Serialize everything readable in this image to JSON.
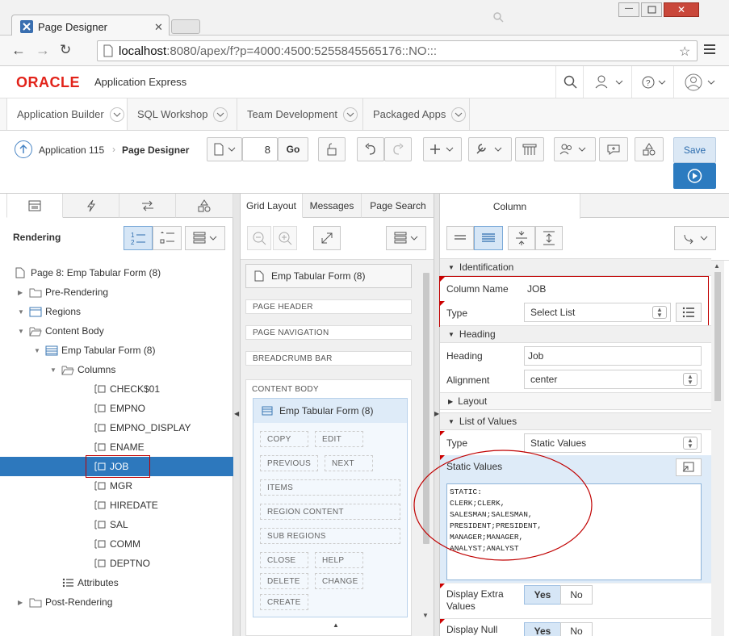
{
  "browser": {
    "tab_title": "Page Designer",
    "url_host": "localhost",
    "url_rest": ":8080/apex/f?p=4000:4500:5255845565176::NO:::"
  },
  "apex": {
    "logo_oracle": "ORACLE",
    "logo_product": "Application Express",
    "nav_tabs": [
      "Application Builder",
      "SQL Workshop",
      "Team Development",
      "Packaged Apps"
    ],
    "breadcrumb_app": "Application 115",
    "breadcrumb_page": "Page Designer",
    "page_number": "8",
    "go_label": "Go",
    "save_label": "Save"
  },
  "left_panel": {
    "heading": "Rendering",
    "tree": [
      {
        "label": "Page 8: Emp Tabular Form (8)",
        "level": 0,
        "icon": "page-icon",
        "toggle": ""
      },
      {
        "label": "Pre-Rendering",
        "level": 1,
        "icon": "folder-icon",
        "toggle": "right"
      },
      {
        "label": "Regions",
        "level": 1,
        "icon": "region-icon",
        "toggle": "down"
      },
      {
        "label": "Content Body",
        "level": 2,
        "icon": "folder-open-icon",
        "toggle": "down"
      },
      {
        "label": "Emp Tabular Form (8)",
        "level": 3,
        "icon": "tabular-form-icon",
        "toggle": "down"
      },
      {
        "label": "Columns",
        "level": 4,
        "icon": "folder-open-icon",
        "toggle": "down"
      },
      {
        "label": "CHECK$01",
        "level": 5,
        "icon": "column-icon",
        "toggle": ""
      },
      {
        "label": "EMPNO",
        "level": 5,
        "icon": "column-icon",
        "toggle": ""
      },
      {
        "label": "EMPNO_DISPLAY",
        "level": 5,
        "icon": "column-icon",
        "toggle": ""
      },
      {
        "label": "ENAME",
        "level": 5,
        "icon": "column-icon",
        "toggle": ""
      },
      {
        "label": "JOB",
        "level": 5,
        "icon": "column-icon",
        "toggle": "",
        "selected": true
      },
      {
        "label": "MGR",
        "level": 5,
        "icon": "column-icon",
        "toggle": ""
      },
      {
        "label": "HIREDATE",
        "level": 5,
        "icon": "column-icon",
        "toggle": ""
      },
      {
        "label": "SAL",
        "level": 5,
        "icon": "column-icon",
        "toggle": ""
      },
      {
        "label": "COMM",
        "level": 5,
        "icon": "column-icon",
        "toggle": ""
      },
      {
        "label": "DEPTNO",
        "level": 5,
        "icon": "column-icon",
        "toggle": ""
      },
      {
        "label": "Attributes",
        "level": 4,
        "icon": "attributes-icon",
        "toggle": ""
      },
      {
        "label": "Post-Rendering",
        "level": 1,
        "icon": "folder-icon",
        "toggle": "right"
      }
    ]
  },
  "mid_panel": {
    "tabs": [
      "Grid Layout",
      "Messages",
      "Page Search"
    ],
    "page_title": "Emp Tabular Form (8)",
    "positions": [
      "PAGE HEADER",
      "PAGE NAVIGATION",
      "BREADCRUMB BAR"
    ],
    "content_body_label": "CONTENT BODY",
    "region_title": "Emp Tabular Form (8)",
    "slots": [
      {
        "label": "COPY"
      },
      {
        "label": "EDIT"
      },
      {
        "label": "PREVIOUS"
      },
      {
        "label": "NEXT"
      },
      {
        "label": "ITEMS"
      },
      {
        "label": "REGION CONTENT"
      },
      {
        "label": "SUB REGIONS"
      },
      {
        "label": "CLOSE"
      },
      {
        "label": "HELP"
      },
      {
        "label": "DELETE"
      },
      {
        "label": "CHANGE"
      },
      {
        "label": "CREATE"
      }
    ]
  },
  "right_panel": {
    "tab": "Column",
    "sections": {
      "identification": "Identification",
      "heading": "Heading",
      "layout": "Layout",
      "lov": "List of Values"
    },
    "column_name_label": "Column Name",
    "column_name_value": "JOB",
    "type_label": "Type",
    "type_value": "Select List",
    "heading_label": "Heading",
    "heading_value": "Job",
    "alignment_label": "Alignment",
    "alignment_value": "center",
    "lov_type_label": "Type",
    "lov_type_value": "Static Values",
    "static_values_label": "Static Values",
    "static_values_text": "STATIC:\nCLERK;CLERK,\nSALESMAN;SALESMAN,\nPRESIDENT;PRESIDENT,\nMANAGER;MANAGER,\nANALYST;ANALYST",
    "display_extra_label": "Display Extra Values",
    "display_null_label": "Display Null",
    "yes_label": "Yes",
    "no_label": "No"
  },
  "colors": {
    "oracle_red": "#e2231a",
    "selection_blue": "#2d78bd",
    "save_blue": "#2c7bc0",
    "annotation_red": "#c00000"
  }
}
